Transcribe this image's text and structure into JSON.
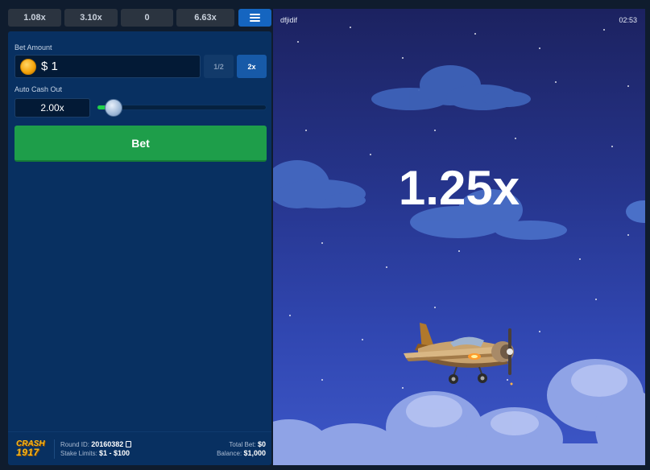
{
  "history": [
    "1.08x",
    "3.10x",
    "0",
    "6.63x"
  ],
  "bet": {
    "amount_label": "Bet Amount",
    "currency": "$",
    "amount": "1",
    "half_label": "1/2",
    "double_label": "2x",
    "auto_cashout_label": "Auto Cash Out",
    "auto_cashout_value": "2.00x",
    "auto_cashout_slider_fraction": 0.1,
    "bet_button_label": "Bet"
  },
  "footer": {
    "logo_line1": "CRASH",
    "logo_line2": "1917",
    "round_id_label": "Round ID:",
    "round_id": "20160382",
    "stake_limits_label": "Stake Limits:",
    "stake_limits": "$1 - $100",
    "total_bet_label": "Total Bet:",
    "total_bet": "$0",
    "balance_label": "Balance:",
    "balance": "$1,000"
  },
  "game": {
    "player_name": "dfjidif",
    "time": "02:53",
    "multiplier": "1.25x"
  },
  "colors": {
    "bet_button": "#1e9e4a",
    "panel": "#083061",
    "accent_blue": "#1565c0",
    "slider_fill": "#1fd14a"
  },
  "icons": [
    "menu-icon",
    "coin-icon",
    "copy-icon",
    "airplane-icon"
  ]
}
